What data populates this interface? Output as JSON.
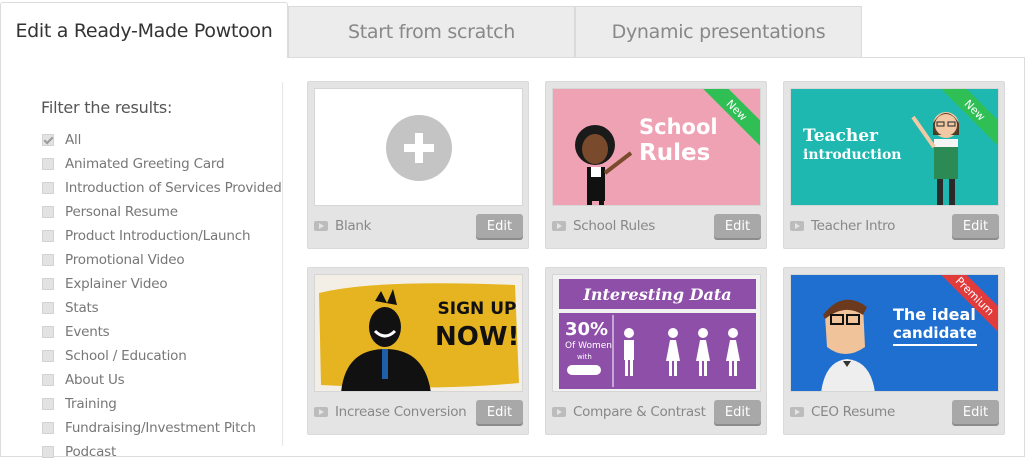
{
  "tabs": [
    {
      "label": "Edit a Ready-Made Powtoon",
      "active": true
    },
    {
      "label": "Start from scratch",
      "active": false
    },
    {
      "label": "Dynamic presentations",
      "active": false
    }
  ],
  "filter": {
    "title": "Filter the results:",
    "items": [
      {
        "label": "All",
        "checked": true
      },
      {
        "label": "Animated Greeting Card",
        "checked": false
      },
      {
        "label": "Introduction of Services Provided",
        "checked": false
      },
      {
        "label": "Personal Resume",
        "checked": false
      },
      {
        "label": "Product Introduction/Launch",
        "checked": false
      },
      {
        "label": "Promotional Video",
        "checked": false
      },
      {
        "label": "Explainer Video",
        "checked": false
      },
      {
        "label": "Stats",
        "checked": false
      },
      {
        "label": "Events",
        "checked": false
      },
      {
        "label": "School / Education",
        "checked": false
      },
      {
        "label": "About Us",
        "checked": false
      },
      {
        "label": "Training",
        "checked": false
      },
      {
        "label": "Fundraising/Investment Pitch",
        "checked": false
      },
      {
        "label": "Podcast",
        "checked": false
      }
    ]
  },
  "templates": [
    {
      "title": "Blank",
      "edit": "Edit"
    },
    {
      "title": "School Rules",
      "edit": "Edit",
      "ribbon": "New",
      "thumb_text": [
        "School",
        "Rules"
      ]
    },
    {
      "title": "Teacher Intro",
      "edit": "Edit",
      "ribbon": "New",
      "thumb_text": [
        "Teacher",
        "introduction"
      ]
    },
    {
      "title": "Increase Conversion",
      "edit": "Edit",
      "thumb_text": [
        "SIGN UP",
        "NOW!"
      ]
    },
    {
      "title": "Compare & Contrast",
      "edit": "Edit",
      "thumb_text": [
        "Interesting Data",
        "30%",
        "Of Women",
        "with"
      ]
    },
    {
      "title": "CEO Resume",
      "edit": "Edit",
      "ribbon": "Premium",
      "thumb_text": [
        "The ideal",
        "candidate"
      ]
    }
  ],
  "colors": {
    "school_bg": "#f0a2b5",
    "teacher_bg": "#1fb8b0",
    "new_ribbon": "#2fbf55",
    "premium_ribbon": "#e23b3b",
    "conversion_bg": "#e7b421",
    "data_purple": "#8e4fa8",
    "ceo_bg": "#1f6fd1"
  }
}
